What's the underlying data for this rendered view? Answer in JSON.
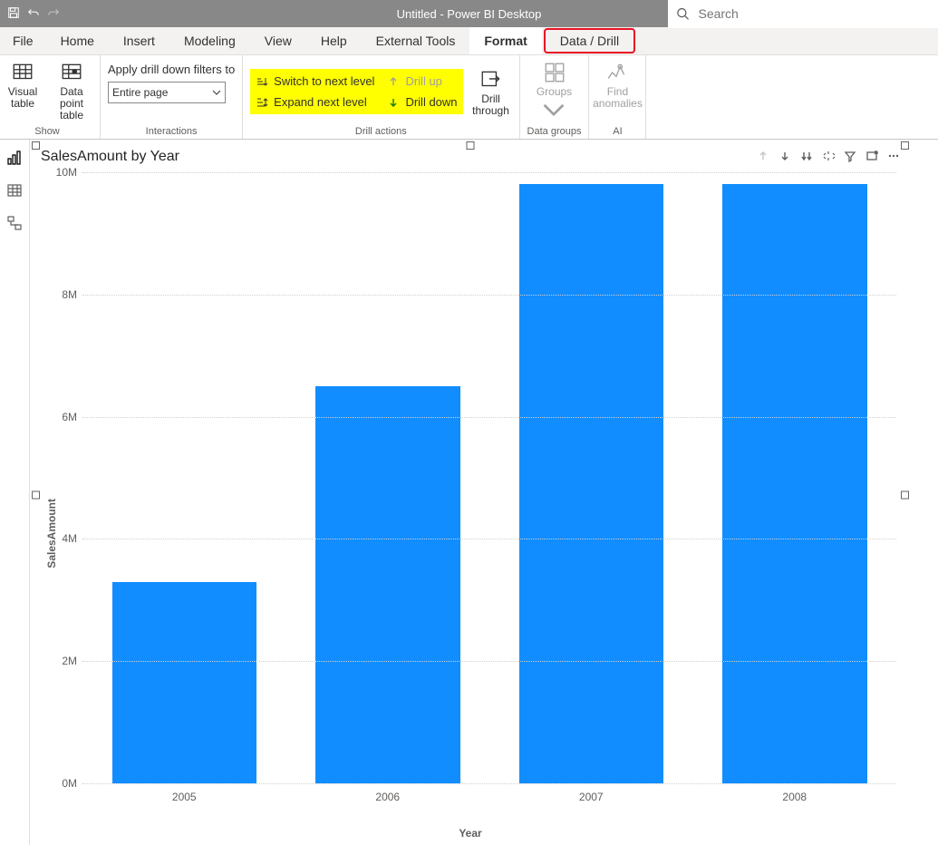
{
  "titlebar": {
    "title": "Untitled - Power BI Desktop",
    "search_placeholder": "Search"
  },
  "tabs": {
    "file": "File",
    "home": "Home",
    "insert": "Insert",
    "modeling": "Modeling",
    "view": "View",
    "help": "Help",
    "external": "External Tools",
    "format": "Format",
    "datadrill": "Data / Drill"
  },
  "ribbon": {
    "show": {
      "visual_table": "Visual\ntable",
      "datapoint_table": "Data point\ntable",
      "label": "Show"
    },
    "interactions": {
      "apply_label": "Apply drill down filters to",
      "select_value": "Entire page",
      "label": "Interactions"
    },
    "drill_actions": {
      "switch_next": "Switch to next level",
      "expand_next": "Expand next level",
      "drill_up": "Drill up",
      "drill_down": "Drill down",
      "drill_through": "Drill\nthrough",
      "label": "Drill actions"
    },
    "data_groups": {
      "groups": "Groups",
      "label": "Data groups"
    },
    "ai": {
      "find_anomalies": "Find\nanomalies",
      "label": "AI"
    }
  },
  "chart_data": {
    "type": "bar",
    "title": "SalesAmount by Year",
    "categories": [
      "2005",
      "2006",
      "2007",
      "2008"
    ],
    "values": [
      3300000,
      6500000,
      9800000,
      9800000
    ],
    "xlabel": "Year",
    "ylabel": "SalesAmount",
    "ylim": [
      0,
      10000000
    ],
    "y_ticks": [
      {
        "v": 0,
        "label": "0M"
      },
      {
        "v": 2000000,
        "label": "2M"
      },
      {
        "v": 4000000,
        "label": "4M"
      },
      {
        "v": 6000000,
        "label": "6M"
      },
      {
        "v": 8000000,
        "label": "8M"
      },
      {
        "v": 10000000,
        "label": "10M"
      }
    ]
  }
}
